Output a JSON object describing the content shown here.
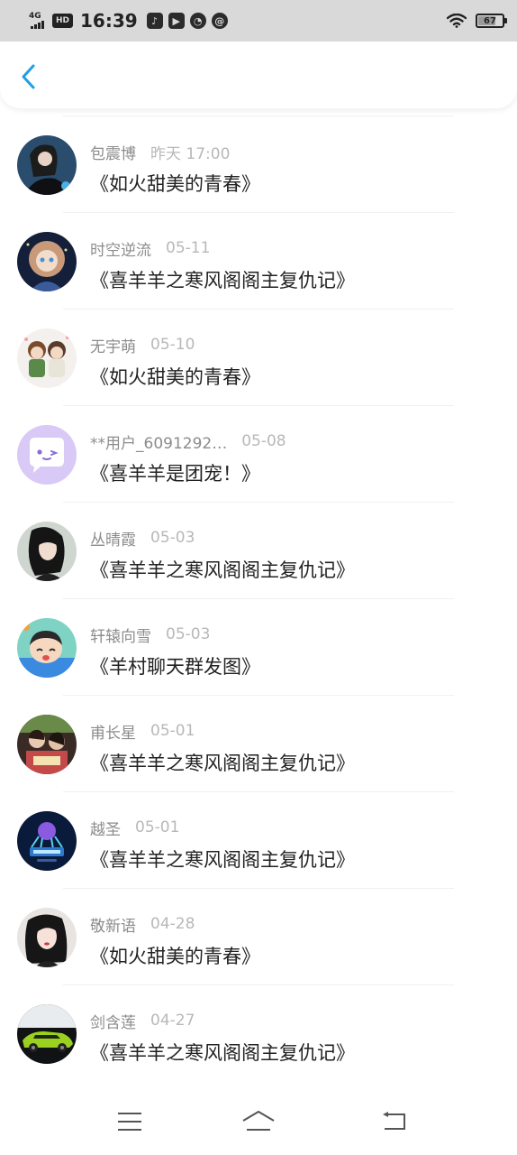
{
  "status_bar": {
    "network": "4G",
    "hd": "HD",
    "time": "16:39",
    "battery": "67",
    "app_icons": [
      "tiktok-icon",
      "video-icon",
      "compass-icon",
      "mail-icon"
    ]
  },
  "header": {
    "back_icon": "chevron-left-icon",
    "accent": "#1e9fe6"
  },
  "items": [
    {
      "name": "包震博",
      "date": "昨天 17:00",
      "title": "《如火甜美的青春》"
    },
    {
      "name": "时空逆流",
      "date": "05-11",
      "title": "《喜羊羊之寒风阁阁主复仇记》"
    },
    {
      "name": "无宇萌",
      "date": "05-10",
      "title": "《如火甜美的青春》"
    },
    {
      "name": "**用户_6091292…",
      "date": "05-08",
      "title": "《喜羊羊是团宠！》"
    },
    {
      "name": "丛晴霞",
      "date": "05-03",
      "title": "《喜羊羊之寒风阁阁主复仇记》"
    },
    {
      "name": "轩辕向雪",
      "date": "05-03",
      "title": "《羊村聊天群发图》"
    },
    {
      "name": "甫长星",
      "date": "05-01",
      "title": "《喜羊羊之寒风阁阁主复仇记》"
    },
    {
      "name": "越圣",
      "date": "05-01",
      "title": "《喜羊羊之寒风阁阁主复仇记》"
    },
    {
      "name": "敬新语",
      "date": "04-28",
      "title": "《如火甜美的青春》"
    },
    {
      "name": "剑含莲",
      "date": "04-27",
      "title": "《喜羊羊之寒风阁阁主复仇记》"
    }
  ],
  "bottom_nav": {
    "menu_icon": "menu-icon",
    "home_icon": "home-icon",
    "back_icon": "back-icon"
  }
}
